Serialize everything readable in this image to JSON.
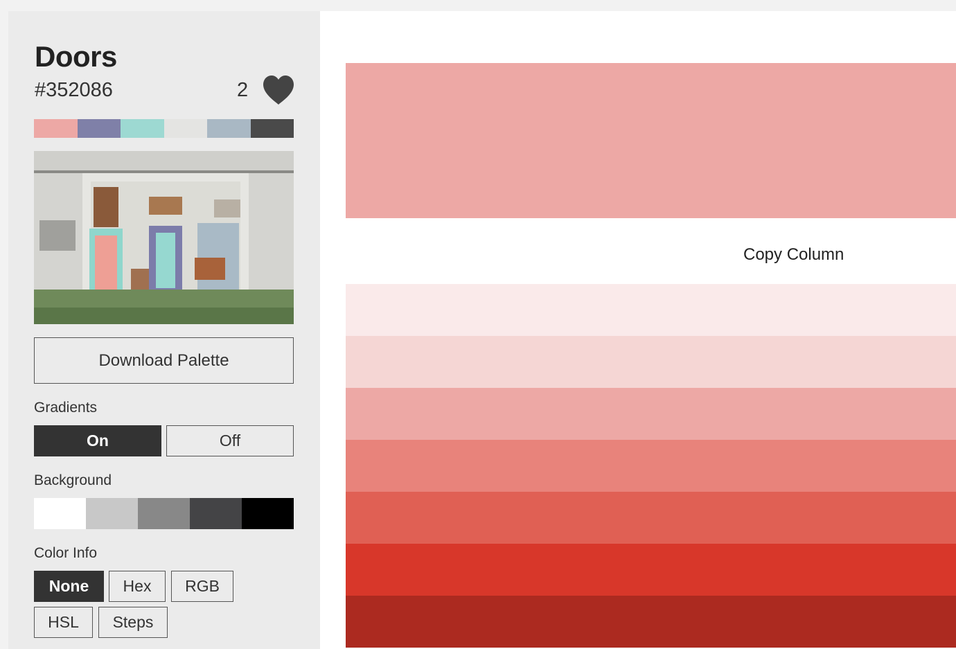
{
  "palette": {
    "name": "Doors",
    "hex": "#352086",
    "likes": "2",
    "colors": [
      "#eda8a5",
      "#7f80a8",
      "#9dd9d2",
      "#e4e4e2",
      "#a9b8c4",
      "#4a4a4a"
    ]
  },
  "sidebar": {
    "download_label": "Download Palette",
    "gradients_label": "Gradients",
    "gradients_on": "On",
    "gradients_off": "Off",
    "background_label": "Background",
    "background_colors": [
      "#ffffff",
      "#c8c8c8",
      "#888888",
      "#444446",
      "#000000"
    ],
    "color_info_label": "Color Info",
    "color_info_options": [
      "None",
      "Hex",
      "RGB",
      "HSL",
      "Steps"
    ]
  },
  "main": {
    "selected_color": "#eda8a5",
    "copy_column_label": "Copy Column",
    "steps": [
      "#faeaea",
      "#f5d6d4",
      "#eda8a5",
      "#e8837b",
      "#e06054",
      "#d8372a",
      "#ac2a20"
    ]
  },
  "icons": {
    "like": "heart-icon"
  }
}
